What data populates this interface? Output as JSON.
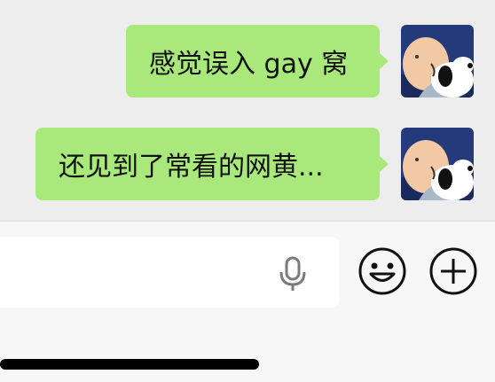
{
  "messages": [
    {
      "text": "感觉误入 gay 窝",
      "sender": "self"
    },
    {
      "text": "还见到了常看的网黄...",
      "sender": "self"
    }
  ],
  "input": {
    "value": ""
  },
  "icons": {
    "voice": "microphone-icon",
    "emoji": "smiley-face-icon",
    "more": "plus-circle-icon"
  },
  "colors": {
    "chat_background": "#ededed",
    "bubble": "#a9e97b",
    "input_panel": "#f7f7f7"
  }
}
